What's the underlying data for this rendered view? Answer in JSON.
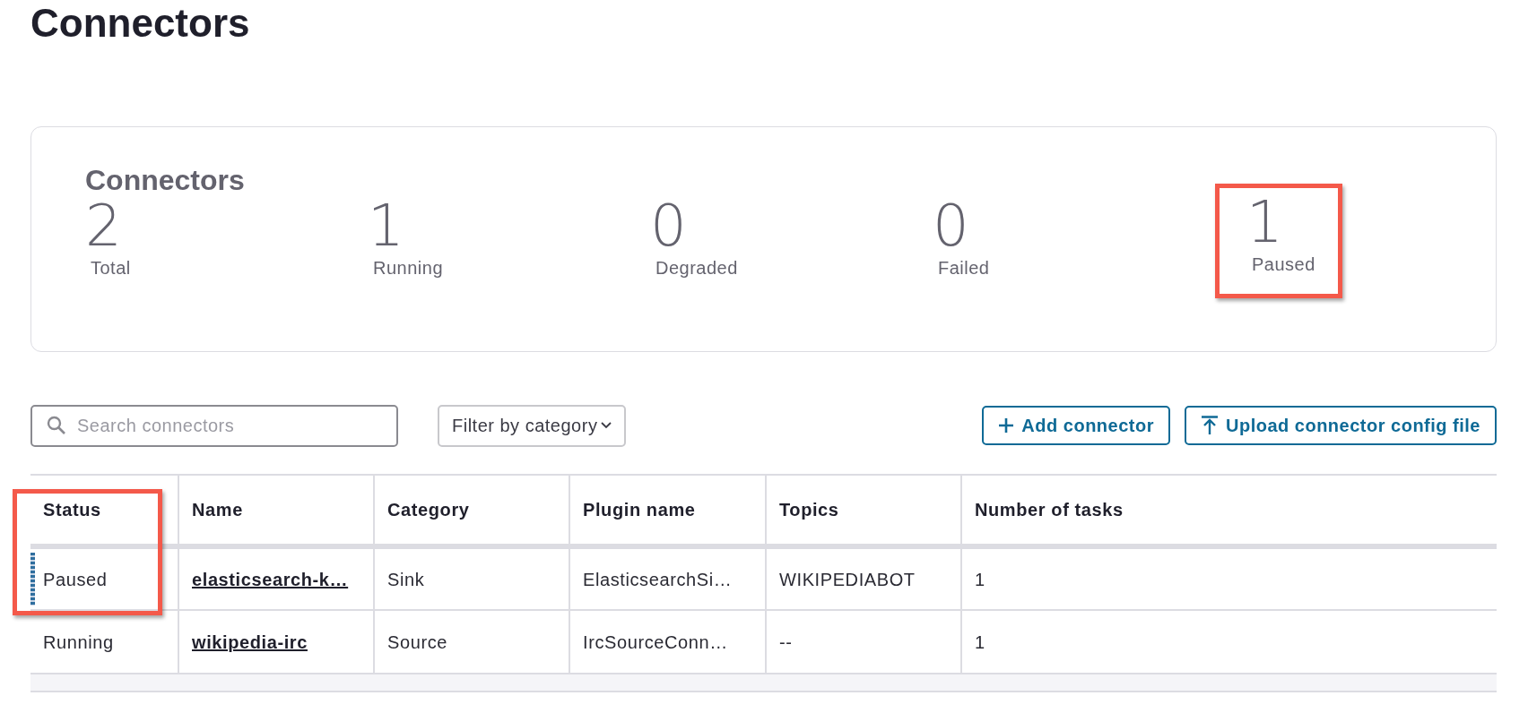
{
  "page_title": "Connectors",
  "summary": {
    "title": "Connectors",
    "stats": [
      {
        "value": "2",
        "label": "Total",
        "highlighted": false
      },
      {
        "value": "1",
        "label": "Running",
        "highlighted": false
      },
      {
        "value": "0",
        "label": "Degraded",
        "highlighted": false
      },
      {
        "value": "0",
        "label": "Failed",
        "highlighted": false
      },
      {
        "value": "1",
        "label": "Paused",
        "highlighted": true
      }
    ]
  },
  "search": {
    "placeholder": "Search connectors"
  },
  "filter": {
    "label": "Filter by category"
  },
  "buttons": [
    {
      "kind": "add",
      "label": "Add connector"
    },
    {
      "kind": "upload",
      "label": "Upload connector config file"
    }
  ],
  "table": {
    "columns": [
      "Status",
      "Name",
      "Category",
      "Plugin name",
      "Topics",
      "Number of tasks"
    ],
    "rows": [
      {
        "kind": "paused",
        "highlighted": true,
        "cells": [
          "Paused",
          "elasticsearch-k…",
          "Sink",
          "ElasticsearchSi…",
          "WIKIPEDIABOT",
          "1"
        ]
      },
      {
        "kind": "running",
        "highlighted": false,
        "cells": [
          "Running",
          "wikipedia-irc",
          "Source",
          "IrcSourceConn…",
          "--",
          "1"
        ]
      }
    ]
  }
}
